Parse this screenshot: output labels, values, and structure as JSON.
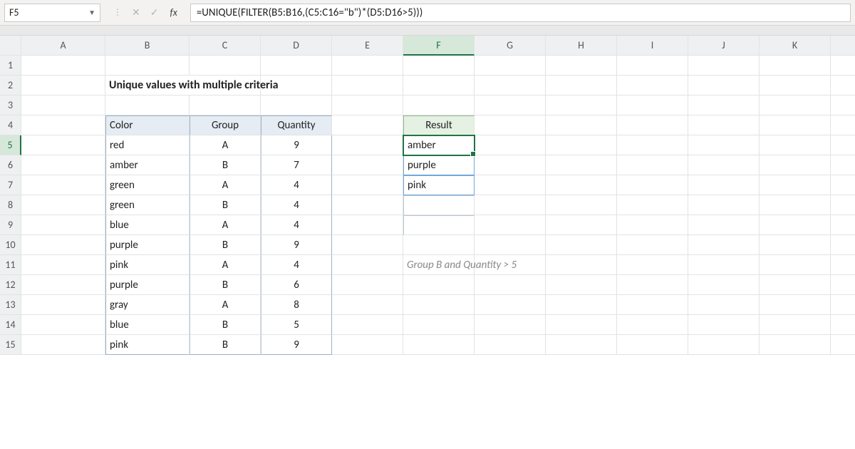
{
  "formula_bar": {
    "cell_ref": "F5",
    "fx_label": "fx",
    "formula": "=UNIQUE(FILTER(B5:B16,(C5:C16=\"b\")*(D5:D16>5)))"
  },
  "columns": [
    "A",
    "B",
    "C",
    "D",
    "E",
    "F",
    "G",
    "H",
    "I",
    "J",
    "K"
  ],
  "rows": [
    "1",
    "2",
    "3",
    "4",
    "5",
    "6",
    "7",
    "8",
    "9",
    "10",
    "11",
    "12",
    "13",
    "14",
    "15"
  ],
  "active_col": "F",
  "active_row": "5",
  "title": "Unique values with multiple criteria",
  "table": {
    "headers": {
      "color": "Color",
      "group": "Group",
      "quantity": "Quantity"
    },
    "rows": [
      {
        "color": "red",
        "group": "A",
        "quantity": "9"
      },
      {
        "color": "amber",
        "group": "B",
        "quantity": "7"
      },
      {
        "color": "green",
        "group": "A",
        "quantity": "4"
      },
      {
        "color": "green",
        "group": "B",
        "quantity": "4"
      },
      {
        "color": "blue",
        "group": "A",
        "quantity": "4"
      },
      {
        "color": "purple",
        "group": "B",
        "quantity": "9"
      },
      {
        "color": "pink",
        "group": "A",
        "quantity": "4"
      },
      {
        "color": "purple",
        "group": "B",
        "quantity": "6"
      },
      {
        "color": "gray",
        "group": "A",
        "quantity": "8"
      },
      {
        "color": "blue",
        "group": "B",
        "quantity": "5"
      },
      {
        "color": "pink",
        "group": "B",
        "quantity": "9"
      }
    ]
  },
  "result": {
    "header": "Result",
    "values": [
      "amber",
      "purple",
      "pink",
      "",
      ""
    ]
  },
  "note": "Group B and Quantity > 5"
}
